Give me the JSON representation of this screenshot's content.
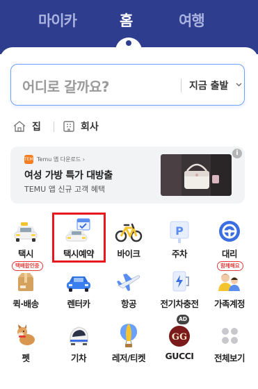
{
  "header": {
    "tabs": [
      {
        "label": "마이카",
        "active": false
      },
      {
        "label": "홈",
        "active": true
      },
      {
        "label": "여행",
        "active": false
      }
    ],
    "bg_color": "#2f3d8f"
  },
  "search": {
    "placeholder": "어디로 갈까요?",
    "departure": "지금 출발"
  },
  "favorites": [
    {
      "label": "집",
      "icon": "home-icon"
    },
    {
      "label": "회사",
      "icon": "building-icon"
    }
  ],
  "ad": {
    "source": "Temu 앱 다운로드 ›",
    "logo_text": "TEMU",
    "title": "여성 가방 특가 대방출",
    "subtitle": "TEMU 앱 신규 고객 혜택",
    "info": "i"
  },
  "services": [
    {
      "label": "택시",
      "icon": "taxi-icon"
    },
    {
      "label": "택시예약",
      "icon": "taxi-reservation-icon",
      "highlighted": true
    },
    {
      "label": "바이크",
      "icon": "bike-icon"
    },
    {
      "label": "주차",
      "icon": "parking-icon"
    },
    {
      "label": "대리",
      "icon": "designated-driver-icon"
    },
    {
      "label": "퀵·배송",
      "icon": "delivery-box-icon",
      "badge": "택배합인중"
    },
    {
      "label": "렌터카",
      "icon": "rental-car-icon"
    },
    {
      "label": "항공",
      "icon": "airplane-icon"
    },
    {
      "label": "전기차충전",
      "icon": "ev-charger-icon"
    },
    {
      "label": "가족계정",
      "icon": "family-account-icon",
      "badge": "함께해요"
    },
    {
      "label": "펫",
      "icon": "pet-icon"
    },
    {
      "label": "기차",
      "icon": "train-icon"
    },
    {
      "label": "레저/티켓",
      "icon": "balloon-icon"
    },
    {
      "label": "GUCCI",
      "icon": "gucci-icon",
      "ad_badge": "AD"
    },
    {
      "label": "전체보기",
      "icon": "view-all-icon"
    }
  ],
  "colors": {
    "accent": "#2f3d8f",
    "search_border": "#6aa0ff",
    "highlight": "#e8171c"
  }
}
